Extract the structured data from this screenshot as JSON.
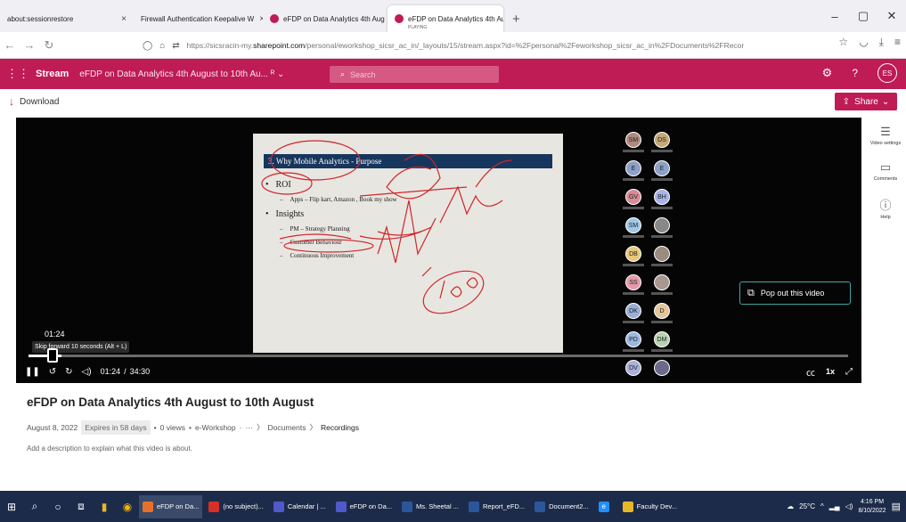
{
  "browser": {
    "tabs": [
      {
        "label": "about:sessionrestore",
        "sub": "",
        "color": "",
        "active": false
      },
      {
        "label": "Firewall Authentication Keepalive W",
        "sub": "",
        "color": "",
        "active": false
      },
      {
        "label": "eFDP on Data Analytics 4th Aug",
        "sub": "",
        "color": "#bf1b55",
        "active": false
      },
      {
        "label": "eFDP on Data Analytics 4th Aug",
        "sub": "PLAYING",
        "color": "#bf1b55",
        "active": true
      }
    ],
    "new_tab": "+",
    "url_host_pre": "https://sicsracin-my.",
    "url_host": "sharepoint.com",
    "url_path": "/personal/eworkshop_sicsr_ac_in/_layouts/15/stream.aspx?id=%2Fpersonal%2Feworkshop_sicsr_ac_in%2FDocuments%2FRecor"
  },
  "stream": {
    "brand": "Stream",
    "title": "eFDP on Data Analytics 4th August to 10th Au...",
    "search_placeholder": "Search",
    "help": "?",
    "avatar_initials": "ES",
    "download_label": "Download",
    "share_label": "Share"
  },
  "video": {
    "slide_heading": "3. Why Mobile Analytics - Purpose",
    "slide_items": [
      {
        "level": 1,
        "text": "ROI"
      },
      {
        "level": 2,
        "text": "Apps – Flip kart, Amazon , Book my show"
      },
      {
        "level": 1,
        "text": "Insights"
      },
      {
        "level": 2,
        "text": "PM – Strategy Planning"
      },
      {
        "level": 2,
        "text": "Customer Behaviour"
      },
      {
        "level": 2,
        "text": "Continuous Improvement"
      }
    ],
    "participants": [
      {
        "initials": "SM",
        "color": "#b08a7e"
      },
      {
        "initials": "DS",
        "color": "#c4a876"
      },
      {
        "initials": "E",
        "color": "#8da0c7"
      },
      {
        "initials": "E",
        "color": "#8da0c7"
      },
      {
        "initials": "GV",
        "color": "#d88a96"
      },
      {
        "initials": "BH",
        "color": "#a6b4e8"
      },
      {
        "initials": "SM",
        "color": "#9fc8e6"
      },
      {
        "initials": "",
        "color": "#888888"
      },
      {
        "initials": "DB",
        "color": "#e8c87a"
      },
      {
        "initials": "",
        "color": "#9a8b80"
      },
      {
        "initials": "SS",
        "color": "#e49aa8"
      },
      {
        "initials": "",
        "color": "#a89890"
      },
      {
        "initials": "DK",
        "color": "#98b0d8"
      },
      {
        "initials": "D",
        "color": "#e3c79a"
      },
      {
        "initials": "PD",
        "color": "#9ab8e0"
      },
      {
        "initials": "DM",
        "color": "#b8d2b0"
      },
      {
        "initials": "DV",
        "color": "#aab0d8"
      },
      {
        "initials": "",
        "color": "#6a6a8a"
      }
    ],
    "popout_label": "Pop out this video",
    "hover_time": "01:24",
    "tooltip": "Skip forward 10 seconds (Alt + L)",
    "current_time": "01:24",
    "duration": "34:30",
    "progress": 0.04,
    "speed": "1x"
  },
  "side_panel": {
    "video_settings": "Video settings",
    "comments": "Comments",
    "help": "Help"
  },
  "info": {
    "title": "eFDP on Data Analytics 4th August to 10th August",
    "date": "August 8, 2022",
    "expires": "Expires in 58 days",
    "views": "0 views",
    "owner": "e-Workshop",
    "ellipsis": "···",
    "crumb_documents": "Documents",
    "crumb_recordings": "Recordings",
    "description": "Add a description to explain what this video is about."
  },
  "taskbar": {
    "apps": [
      {
        "label": "eFDP on Da...",
        "color": "#e8702a",
        "active": true
      },
      {
        "label": "(no subject)...",
        "color": "#d93025",
        "active": false
      },
      {
        "label": "Calendar | ...",
        "color": "#5059c9",
        "active": false
      },
      {
        "label": "eFDP on Da...",
        "color": "#5059c9",
        "active": false
      },
      {
        "label": "Ms. Sheetal ...",
        "color": "#2b579a",
        "active": false
      },
      {
        "label": "Report_eFD...",
        "color": "#2b579a",
        "active": false
      },
      {
        "label": "Document2...",
        "color": "#2b579a",
        "active": false
      },
      {
        "label": "",
        "color": "#1e90ff",
        "active": false
      },
      {
        "label": "Faculty Dev...",
        "color": "#e8b62a",
        "active": false
      }
    ],
    "temperature": "25°C",
    "time": "4:16 PM",
    "date": "8/10/2022"
  }
}
